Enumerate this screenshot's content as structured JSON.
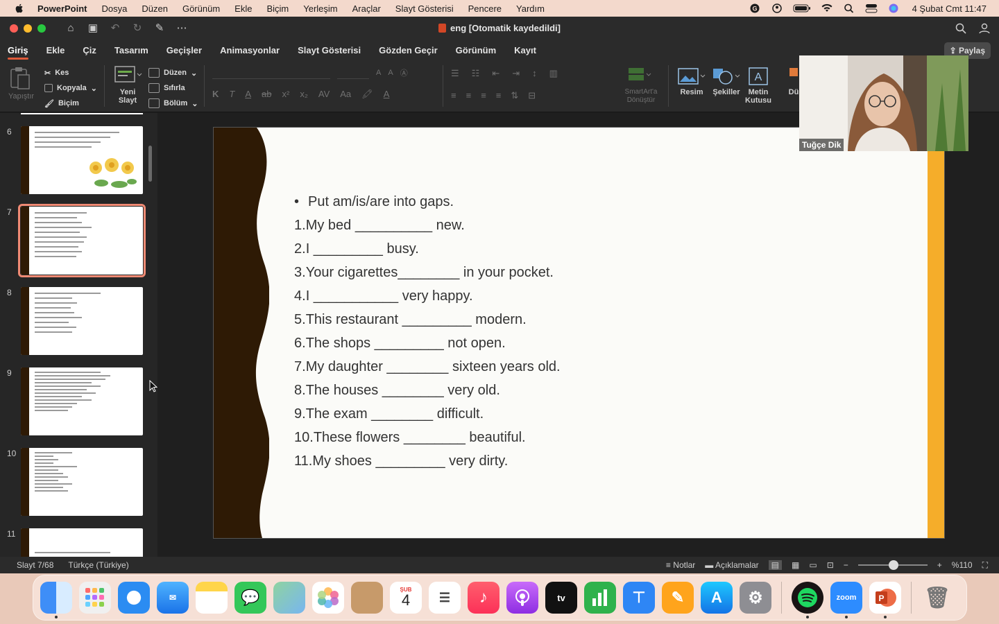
{
  "menubar": {
    "app_name": "PowerPoint",
    "items": [
      "Dosya",
      "Düzen",
      "Görünüm",
      "Ekle",
      "Biçim",
      "Yerleşim",
      "Araçlar",
      "Slayt Gösterisi",
      "Pencere",
      "Yardım"
    ],
    "clock": "4 Şubat Cmt  11:47"
  },
  "window": {
    "title": "eng [Otomatik kaydedildi]"
  },
  "ribbon": {
    "tabs": [
      "Giriş",
      "Ekle",
      "Çiz",
      "Tasarım",
      "Geçişler",
      "Animasyonlar",
      "Slayt Gösterisi",
      "Gözden Geçir",
      "Görünüm",
      "Kayıt"
    ],
    "active_tab": "Giriş",
    "share_label": "Paylaş",
    "paste_label": "Yapıştır",
    "cut_label": "Kes",
    "copy_label": "Kopyala",
    "format_label": "Biçim",
    "new_slide_label": "Yeni Slayt",
    "layout_label": "Düzen",
    "reset_label": "Sıfırla",
    "section_label": "Bölüm",
    "smartart_label": "SmartArt'a Dönüştür",
    "picture_label": "Resim",
    "shapes_label": "Şekiller",
    "textbox_label": "Metin Kutusu",
    "arrange_label": "Dü"
  },
  "thumbnails": {
    "numbers": [
      "6",
      "7",
      "8",
      "9",
      "10",
      "11"
    ],
    "selected": "7"
  },
  "slide": {
    "bullet": "Put am/is/are into gaps.",
    "items": [
      {
        "num": "1.",
        "text": "My bed __________ new."
      },
      {
        "num": "2.",
        "text": "I _________ busy."
      },
      {
        "num": "3.",
        "text": "Your cigarettes________ in your pocket."
      },
      {
        "num": "4.",
        "text": "I ___________ very happy."
      },
      {
        "num": "5.",
        "text": "This restaurant _________ modern."
      },
      {
        "num": "6.",
        "text": "The shops _________ not open."
      },
      {
        "num": "7.",
        "text": "My daughter ________ sixteen years old."
      },
      {
        "num": "8.",
        "text": "The houses ________ very old."
      },
      {
        "num": "9.",
        "text": "The exam ________ difficult."
      },
      {
        "num": "10.",
        "text": "These flowers ________ beautiful."
      },
      {
        "num": "11.",
        "text": "My shoes _________ very dirty."
      }
    ]
  },
  "webcam": {
    "participant_name": "Tuğçe Dik"
  },
  "statusbar": {
    "slide_counter": "Slayt 7/68",
    "language": "Türkçe (Türkiye)",
    "notes_label": "Notlar",
    "comments_label": "Açıklamalar",
    "zoom": "%110"
  },
  "dock": {
    "calendar_month": "ŞUB",
    "calendar_day": "4",
    "zoom_label": "zoom"
  },
  "colors": {
    "accent_tab": "#e05a3a",
    "slide_band": "#2e1a05",
    "slide_accent": "#f5ad2a",
    "selection": "#f08a74"
  }
}
